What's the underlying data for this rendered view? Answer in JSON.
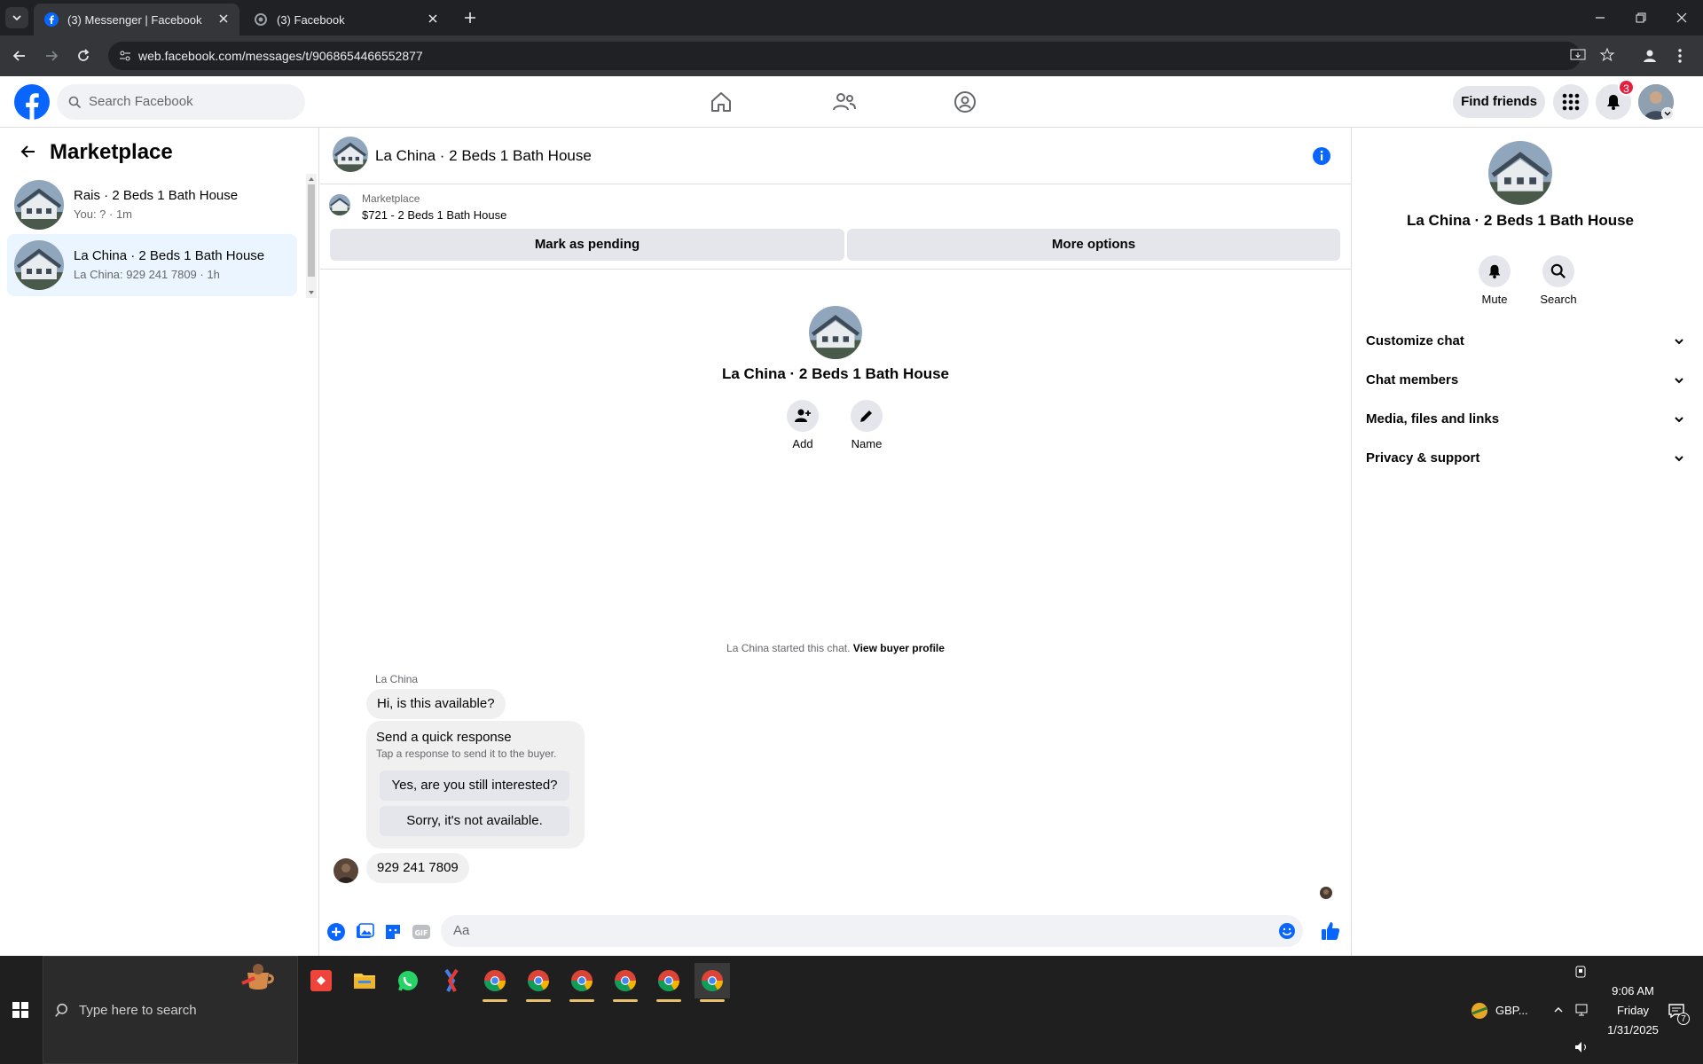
{
  "browser": {
    "tabs": [
      {
        "title": "(3) Messenger | Facebook",
        "active": true
      },
      {
        "title": "(3) Facebook",
        "active": false
      }
    ],
    "url": "web.facebook.com/messages/t/9068654466552877"
  },
  "fb_header": {
    "search_placeholder": "Search Facebook",
    "find_friends": "Find friends",
    "notification_count": "3",
    "brand_color": "#0866ff"
  },
  "left_panel": {
    "title": "Marketplace",
    "conversations": [
      {
        "name": "Rais · 2 Beds 1 Bath House",
        "preview": "You: ? · 1m",
        "selected": false
      },
      {
        "name": "La China · 2 Beds 1 Bath House",
        "preview": "La China: 929 241 7809 · 1h",
        "selected": true
      }
    ]
  },
  "chat": {
    "title": "La China · 2 Beds 1 Bath House",
    "marketplace_label": "Marketplace",
    "listing": "$721 - 2 Beds 1 Bath House",
    "mark_pending": "Mark as pending",
    "more_options": "More options",
    "profile_name": "La China · 2 Beds 1 Bath House",
    "add_label": "Add",
    "name_label": "Name",
    "started_text": "La China started this chat.",
    "view_buyer": "View buyer profile",
    "sender_name": "La China",
    "message_1": "Hi, is this available?",
    "quick_title": "Send a quick response",
    "quick_sub": "Tap a response to send it to the buyer.",
    "quick_1": "Yes, are you still interested?",
    "quick_2": "Sorry, it's not available.",
    "message_2": "929 241 7809",
    "composer_placeholder": "Aa"
  },
  "right_panel": {
    "name": "La China · 2 Beds 1 Bath House",
    "mute": "Mute",
    "search": "Search",
    "sections": [
      "Customize chat",
      "Chat members",
      "Media, files and links",
      "Privacy & support"
    ]
  },
  "taskbar": {
    "search_placeholder": "Type here to search",
    "currency": "GBP...",
    "time": "9:06 AM",
    "day": "Friday",
    "date": "1/31/2025",
    "notif_count": "7"
  }
}
